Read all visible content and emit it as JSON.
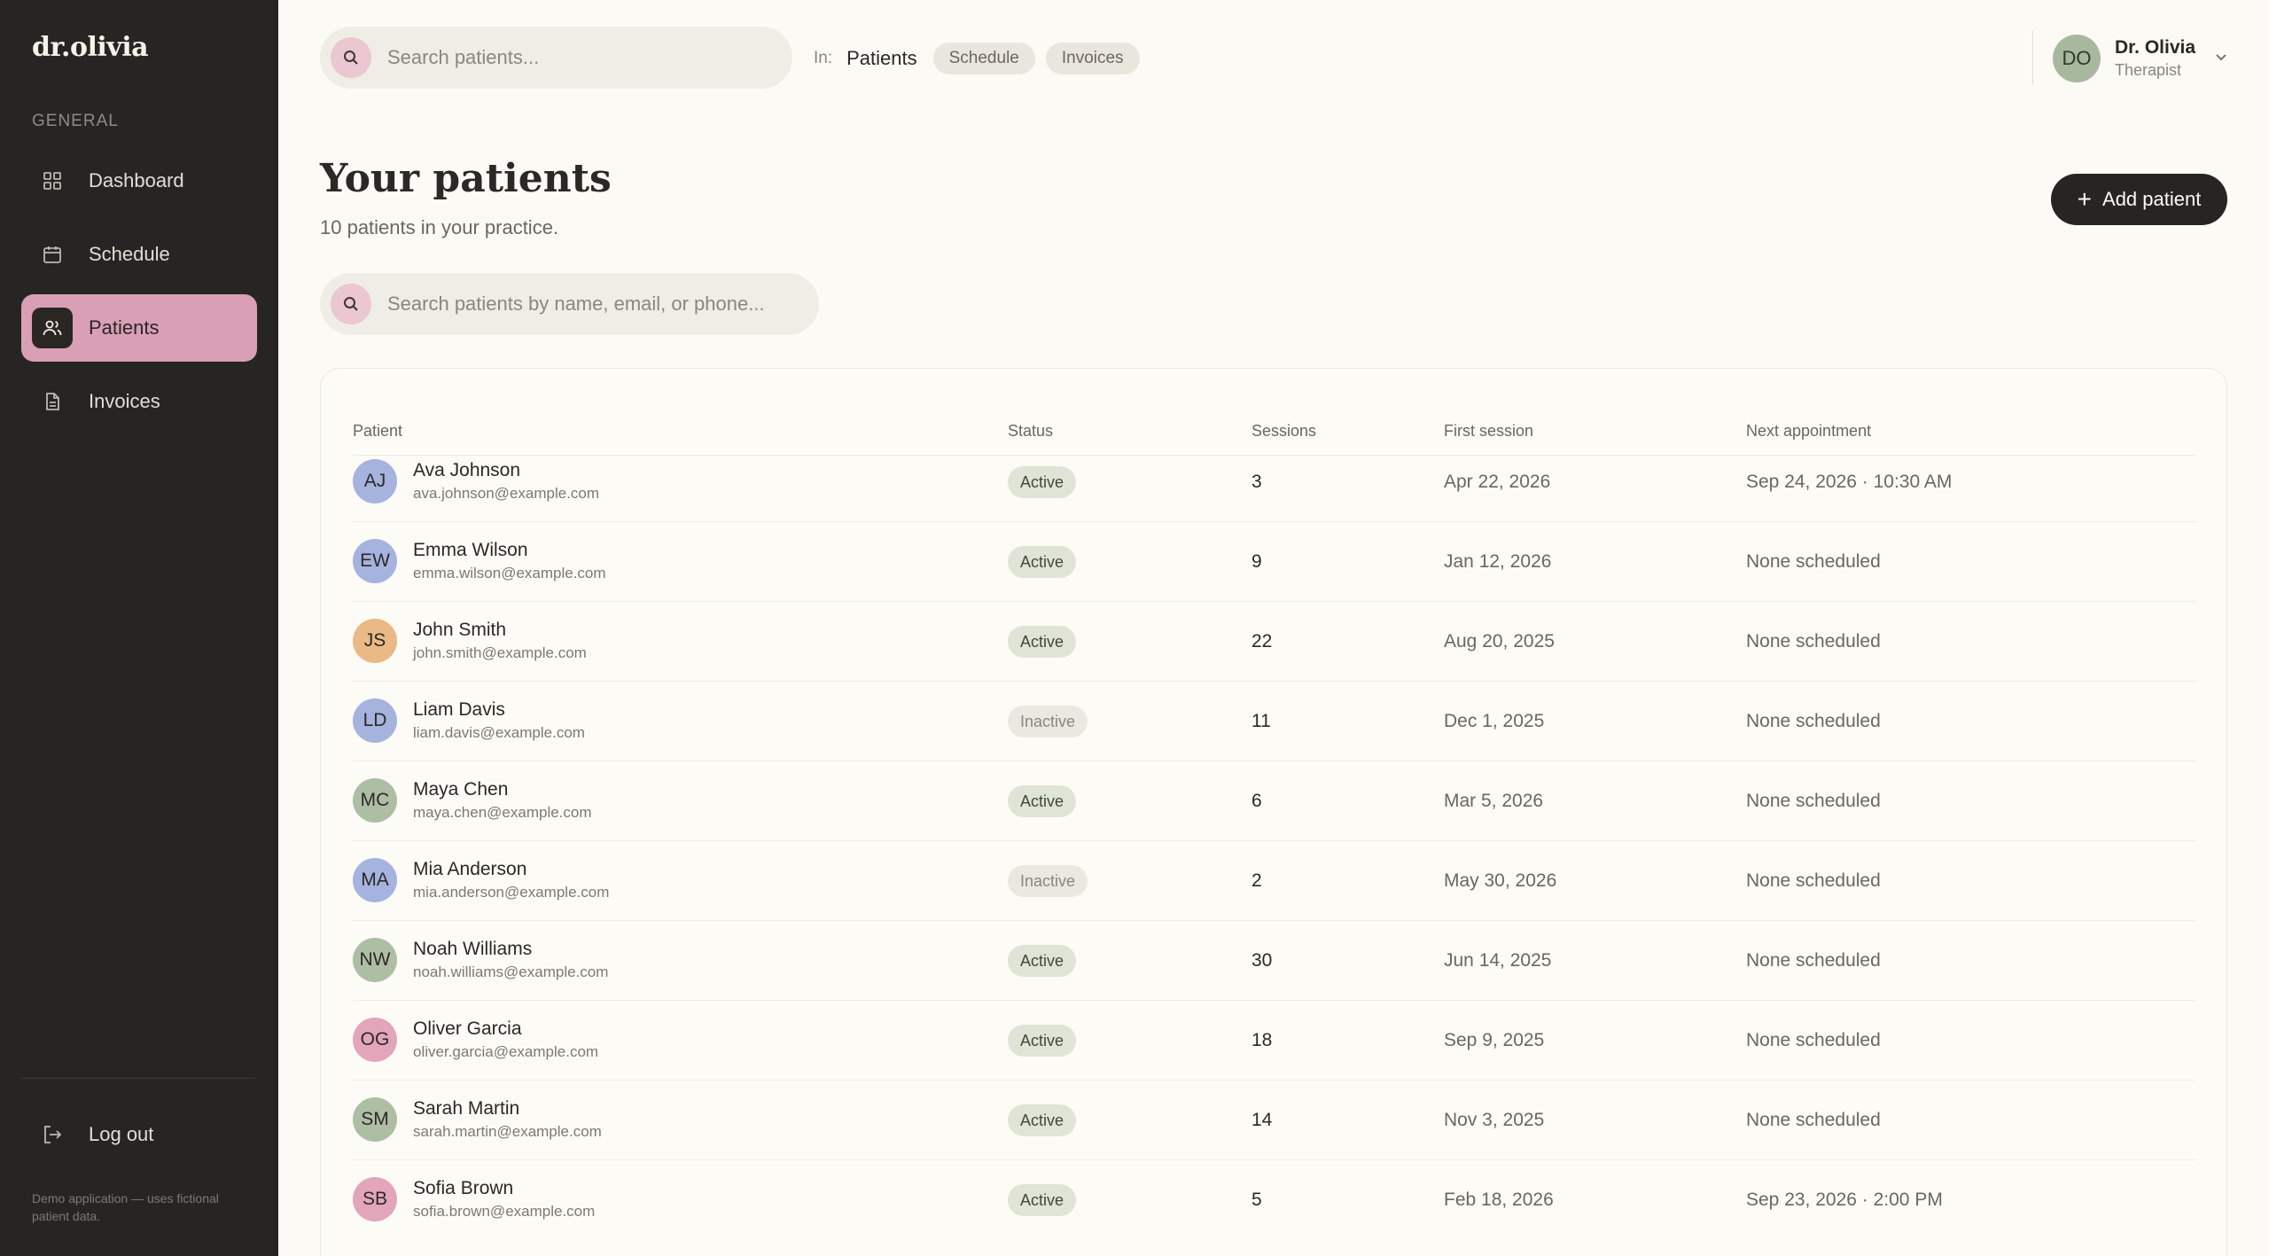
{
  "app": {
    "logo": "dr.olivia",
    "section_label": "GENERAL",
    "nav": [
      {
        "label": "Dashboard",
        "icon": "grid-icon"
      },
      {
        "label": "Schedule",
        "icon": "calendar-icon"
      },
      {
        "label": "Patients",
        "icon": "users-icon",
        "active": true
      },
      {
        "label": "Invoices",
        "icon": "document-icon"
      }
    ],
    "logout_label": "Log out",
    "demo_note": "Demo application — uses fictional patient data."
  },
  "header": {
    "search_placeholder": "Search patients...",
    "scope_label": "In:",
    "scope_active": "Patients",
    "scope_chips": [
      "Schedule",
      "Invoices"
    ],
    "user": {
      "initials": "DO",
      "name": "Dr. Olivia",
      "role": "Therapist"
    }
  },
  "page": {
    "title": "Your patients",
    "subtitle": "10 patients in your practice.",
    "add_button": "Add patient",
    "list_search_placeholder": "Search patients by name, email, or phone..."
  },
  "table": {
    "columns": [
      "Patient",
      "Status",
      "Sessions",
      "First session",
      "Next appointment"
    ],
    "rows": [
      {
        "initials": "AJ",
        "color": "#a6b3de",
        "name": "Ava Johnson",
        "email": "ava.johnson@example.com",
        "status": "Active",
        "sessions": "3",
        "first": "Apr 22, 2026",
        "next": "Sep 24, 2026 · 10:30 AM"
      },
      {
        "initials": "EW",
        "color": "#a6b3de",
        "name": "Emma Wilson",
        "email": "emma.wilson@example.com",
        "status": "Active",
        "sessions": "9",
        "first": "Jan 12, 2026",
        "next": "None scheduled"
      },
      {
        "initials": "JS",
        "color": "#eab985",
        "name": "John Smith",
        "email": "john.smith@example.com",
        "status": "Active",
        "sessions": "22",
        "first": "Aug 20, 2025",
        "next": "None scheduled"
      },
      {
        "initials": "LD",
        "color": "#a6b3de",
        "name": "Liam Davis",
        "email": "liam.davis@example.com",
        "status": "Inactive",
        "sessions": "11",
        "first": "Dec 1, 2025",
        "next": "None scheduled"
      },
      {
        "initials": "MC",
        "color": "#aebea4",
        "name": "Maya Chen",
        "email": "maya.chen@example.com",
        "status": "Active",
        "sessions": "6",
        "first": "Mar 5, 2026",
        "next": "None scheduled"
      },
      {
        "initials": "MA",
        "color": "#a6b3de",
        "name": "Mia Anderson",
        "email": "mia.anderson@example.com",
        "status": "Inactive",
        "sessions": "2",
        "first": "May 30, 2026",
        "next": "None scheduled"
      },
      {
        "initials": "NW",
        "color": "#aebea4",
        "name": "Noah Williams",
        "email": "noah.williams@example.com",
        "status": "Active",
        "sessions": "30",
        "first": "Jun 14, 2025",
        "next": "None scheduled"
      },
      {
        "initials": "OG",
        "color": "#e3a5bb",
        "name": "Oliver Garcia",
        "email": "oliver.garcia@example.com",
        "status": "Active",
        "sessions": "18",
        "first": "Sep 9, 2025",
        "next": "None scheduled"
      },
      {
        "initials": "SM",
        "color": "#aebea4",
        "name": "Sarah Martin",
        "email": "sarah.martin@example.com",
        "status": "Active",
        "sessions": "14",
        "first": "Nov 3, 2025",
        "next": "None scheduled"
      },
      {
        "initials": "SB",
        "color": "#e3a5bb",
        "name": "Sofia Brown",
        "email": "sofia.brown@example.com",
        "status": "Active",
        "sessions": "5",
        "first": "Feb 18, 2026",
        "next": "Sep 23, 2026 · 2:00 PM"
      }
    ]
  }
}
